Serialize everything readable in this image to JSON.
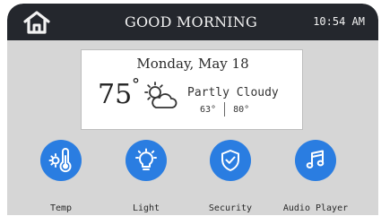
{
  "header": {
    "home_icon": "home-icon",
    "greeting": "GOOD MORNING",
    "time": "10:54 AM"
  },
  "weather": {
    "date": "Monday, May 18",
    "current_temp": "75",
    "degree": "°",
    "condition_icon": "partly-cloudy-icon",
    "condition": "Partly Cloudy",
    "low": "63°",
    "high": "80°"
  },
  "controls": [
    {
      "label": "Temp",
      "icon": "thermometer-icon"
    },
    {
      "label": "Light",
      "icon": "lightbulb-icon"
    },
    {
      "label": "Security",
      "icon": "shield-check-icon"
    },
    {
      "label": "Audio Player",
      "icon": "music-note-icon"
    }
  ],
  "colors": {
    "topbar": "#24272d",
    "panel": "#d6d6d6",
    "accent": "#2a7de1"
  }
}
